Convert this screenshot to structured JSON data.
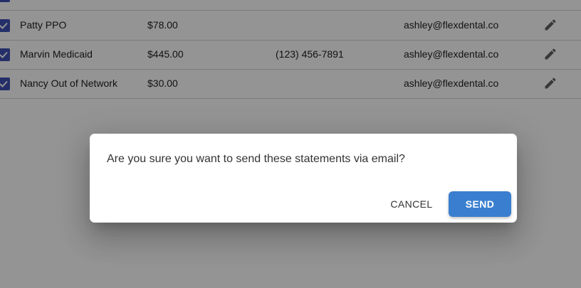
{
  "table": {
    "rows": [
      {
        "checked": true,
        "name": "",
        "amount": "",
        "phone": "",
        "email": ""
      },
      {
        "checked": true,
        "name": "Patty PPO",
        "amount": "$78.00",
        "phone": "",
        "email": "ashley@flexdental.co"
      },
      {
        "checked": true,
        "name": "Marvin Medicaid",
        "amount": "$445.00",
        "phone": "(123) 456-7891",
        "email": "ashley@flexdental.co"
      },
      {
        "checked": true,
        "name": "Nancy Out of Network",
        "amount": "$30.00",
        "phone": "",
        "email": "ashley@flexdental.co"
      }
    ],
    "edit_icon": "pencil-icon",
    "checkbox_color": "#3f51b5"
  },
  "dialog": {
    "message": "Are you sure you want to send these statements via email?",
    "cancel_label": "CANCEL",
    "send_label": "SEND",
    "send_color": "#3a7fcf"
  }
}
